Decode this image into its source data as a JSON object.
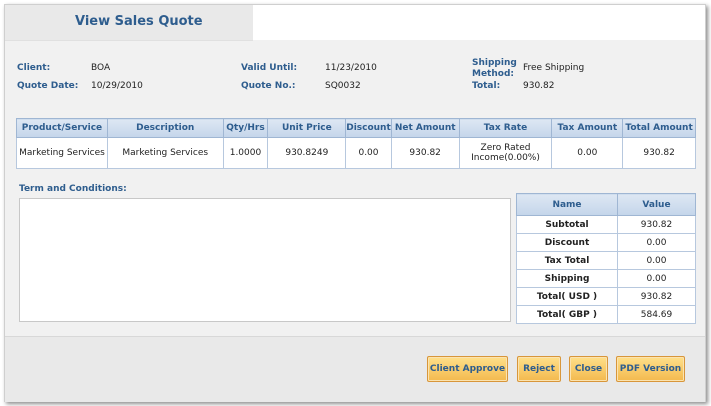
{
  "header": {
    "title": "View Sales Quote"
  },
  "quote_info": {
    "client_label": "Client:",
    "client_value": "BOA",
    "quote_date_label": "Quote Date:",
    "quote_date_value": "10/29/2010",
    "valid_until_label": "Valid Until:",
    "valid_until_value": "11/23/2010",
    "quote_no_label": "Quote No.:",
    "quote_no_value": "SQ0032",
    "shipping_method_label": "Shipping Method:",
    "shipping_method_value": "Free Shipping",
    "total_label": "Total:",
    "total_value": "930.82"
  },
  "items_table": {
    "headers": [
      "Product/Service",
      "Description",
      "Qty/Hrs",
      "Unit Price",
      "Discount",
      "Net Amount",
      "Tax Rate",
      "Tax Amount",
      "Total Amount"
    ],
    "rows": [
      [
        "Marketing Services",
        "Marketing Services",
        "1.0000",
        "930.8249",
        "0.00",
        "930.82",
        "Zero Rated Income(0.00%)",
        "0.00",
        "930.82"
      ]
    ]
  },
  "terms": {
    "label": "Term and Conditions:",
    "value": ""
  },
  "summary": {
    "headers": [
      "Name",
      "Value"
    ],
    "rows": [
      [
        "Subtotal",
        "930.82"
      ],
      [
        "Discount",
        "0.00"
      ],
      [
        "Tax Total",
        "0.00"
      ],
      [
        "Shipping",
        "0.00"
      ],
      [
        "Total( USD )",
        "930.82"
      ],
      [
        "Total( GBP )",
        "584.69"
      ]
    ]
  },
  "buttons": {
    "client_approve": "Client Approve",
    "reject": "Reject",
    "close": "Close",
    "pdf_version": "PDF Version"
  },
  "colors": {
    "accent": "#2e5d8e",
    "button": "#f3b94e",
    "table_header": "#c4d5ea"
  }
}
